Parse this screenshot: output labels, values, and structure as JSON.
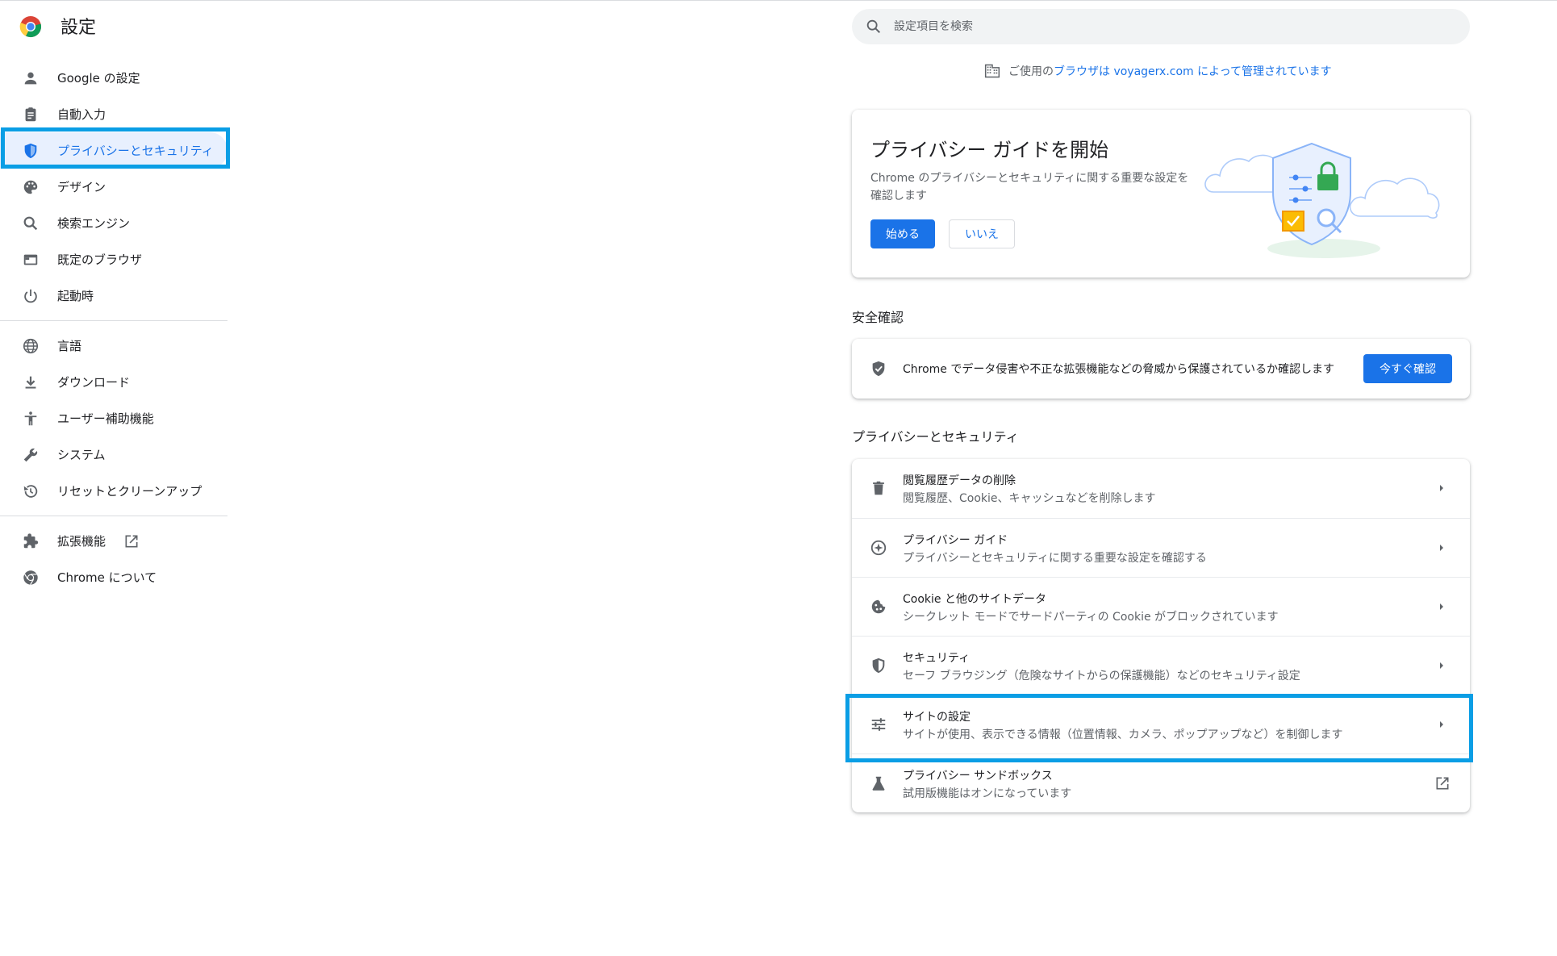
{
  "app": {
    "title": "設定"
  },
  "search": {
    "placeholder": "設定項目を検索"
  },
  "sidebar": {
    "items": [
      {
        "label": "Google の設定",
        "icon": "person-icon"
      },
      {
        "label": "自動入力",
        "icon": "clipboard-icon"
      },
      {
        "label": "プライバシーとセキュリティ",
        "icon": "shield-icon",
        "active": true
      },
      {
        "label": "デザイン",
        "icon": "palette-icon"
      },
      {
        "label": "検索エンジン",
        "icon": "search-icon"
      },
      {
        "label": "既定のブラウザ",
        "icon": "browser-icon"
      },
      {
        "label": "起動時",
        "icon": "power-icon"
      },
      {
        "label": "言語",
        "icon": "globe-icon"
      },
      {
        "label": "ダウンロード",
        "icon": "download-icon"
      },
      {
        "label": "ユーザー補助機能",
        "icon": "accessibility-icon"
      },
      {
        "label": "システム",
        "icon": "wrench-icon"
      },
      {
        "label": "リセットとクリーンアップ",
        "icon": "history-icon"
      },
      {
        "label": "拡張機能",
        "icon": "puzzle-icon"
      },
      {
        "label": "Chrome について",
        "icon": "chrome-icon"
      }
    ]
  },
  "managed": {
    "prefix": "ご使用の",
    "link": "ブラウザ",
    "suffix": "は voyagerx.com によって管理されています"
  },
  "privacy_guide": {
    "title": "プライバシー ガイドを開始",
    "description": "Chrome のプライバシーとセキュリティに関する重要な設定を確認します",
    "start_label": "始める",
    "no_label": "いいえ"
  },
  "safety_check": {
    "heading": "安全確認",
    "text": "Chrome でデータ侵害や不正な拡張機能などの脅威から保護されているか確認します",
    "button_label": "今すぐ確認"
  },
  "privacy_section": {
    "heading": "プライバシーとセキュリティ",
    "rows": [
      {
        "title": "閲覧履歴データの削除",
        "subtitle": "閲覧履歴、Cookie、キャッシュなどを削除します",
        "icon": "trash-icon"
      },
      {
        "title": "プライバシー ガイド",
        "subtitle": "プライバシーとセキュリティに関する重要な設定を確認する",
        "icon": "compass-icon"
      },
      {
        "title": "Cookie と他のサイトデータ",
        "subtitle": "シークレット モードでサードパーティの Cookie がブロックされています",
        "icon": "cookie-icon"
      },
      {
        "title": "セキュリティ",
        "subtitle": "セーフ ブラウジング（危険なサイトからの保護機能）などのセキュリティ設定",
        "icon": "shield-icon"
      },
      {
        "title": "サイトの設定",
        "subtitle": "サイトが使用、表示できる情報（位置情報、カメラ、ポップアップなど）を制御します",
        "icon": "tune-icon"
      },
      {
        "title": "プライバシー サンドボックス",
        "subtitle": "試用版機能はオンになっています",
        "icon": "flask-icon"
      }
    ]
  },
  "colors": {
    "accent": "#1a73e8",
    "highlight": "#0a9ee5"
  }
}
